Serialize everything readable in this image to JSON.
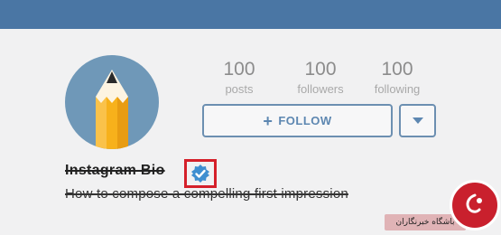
{
  "colors": {
    "topbar": "#4a76a4",
    "accent": "#5d87b1",
    "highlight_box": "#d5202a",
    "verified_badge": "#3e8ed0",
    "avatar_bg": "#6f98b8"
  },
  "profile": {
    "name": "Instagram Bio",
    "bio": "How to compose a compelling first impression",
    "avatar_icon": "pencil-icon",
    "verified_icon": "verified-badge-icon"
  },
  "stats": [
    {
      "value": "100",
      "label": "posts"
    },
    {
      "value": "100",
      "label": "followers"
    },
    {
      "value": "100",
      "label": "following"
    }
  ],
  "actions": {
    "follow_label": "FOLLOW",
    "follow_icon": "plus-icon",
    "dropdown_icon": "caret-down-icon"
  },
  "watermark": {
    "text": "باشگاه خبرنگاران"
  }
}
